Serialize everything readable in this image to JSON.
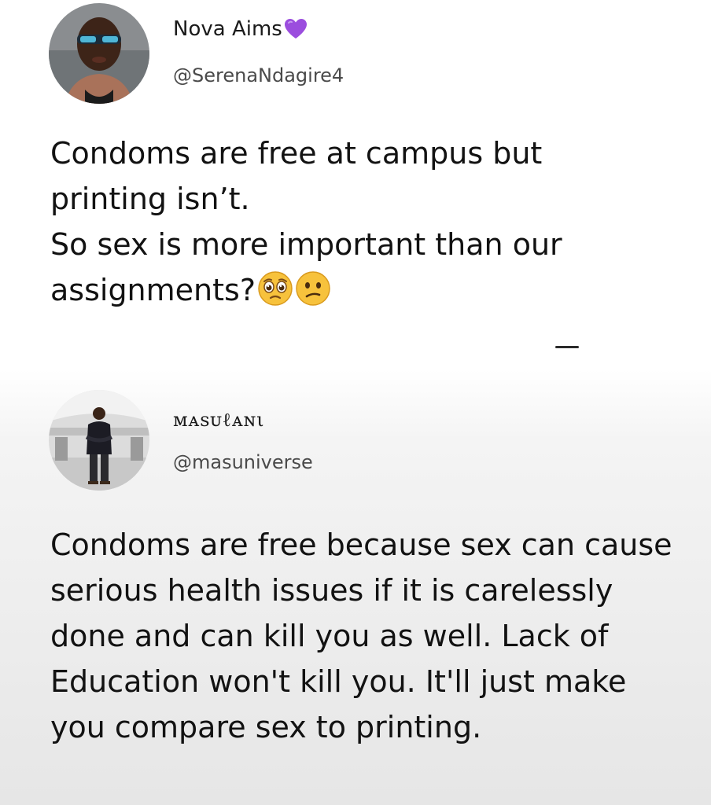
{
  "tweets": [
    {
      "display_name": "Nova Aims",
      "name_badge": "purple-heart-icon",
      "handle": "@SerenaNdagire4",
      "text_lines": [
        "Condoms are free at campus but",
        "printing isn’t.",
        "So sex is more important than our",
        "assignments?"
      ],
      "emojis": [
        "pleading-face-icon",
        "confused-face-icon"
      ]
    },
    {
      "display_name": "ᴍᴀsᴜℓᴀɴι",
      "handle": "@masuniverse",
      "text": "Condoms are free because sex can cause serious health issues if it is carelessly done and can kill you as well. Lack of Education won't kill you. It'll just make you compare sex to printing."
    }
  ],
  "colors": {
    "heart": "#9b4dde",
    "emoji_face": "#f7c23c",
    "text": "#141414",
    "handle": "#4a4a4a"
  }
}
